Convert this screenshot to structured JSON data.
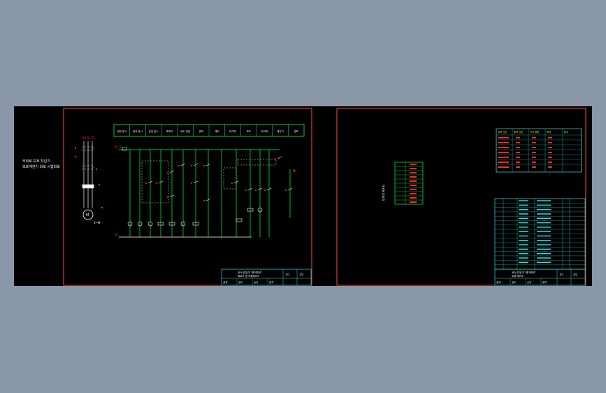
{
  "colors": {
    "background": "#8a97a8",
    "canvas": "#000000",
    "frame": "#ff4d4d",
    "wire_green": "#00ff44",
    "label_red": "#ff2a2a",
    "text_white": "#ffffff",
    "table_cyan": "#2fe0e0",
    "table_yellow": "#ffff00",
    "dashed_white": "#dddddd"
  },
  "sheet1": {
    "side_note": [
      "주회로 보호 차단기",
      "보호계전기 회로 시험회로"
    ],
    "header_cells": [
      "전원 표시",
      "정지 표시",
      "운전 표시",
      "과부하",
      "유도 전동",
      "경보",
      "제어",
      "타이머",
      "보조",
      "타이머",
      "계전기",
      "경보"
    ],
    "terminals": {
      "top": "R1 S1",
      "bottom": "S2"
    },
    "power_phases": "R1 S1 T1",
    "motor": {
      "label": "M",
      "tag": "3~M"
    },
    "title_block": {
      "title": "유도전동기 제어회로",
      "subtitle": "회로도 및 부품배치도",
      "scale": "1/1",
      "sheet": "1/2",
      "fields": [
        "설계",
        "검도",
        "승인",
        "일자"
      ]
    }
  },
  "sheet2": {
    "terminal_label": "단자대 배치도",
    "yellow_table": {
      "headers": [
        "입력 신호",
        "출력 신호",
        "기기 명칭",
        "정격",
        "비고"
      ],
      "rows": 7
    },
    "parts_list_rows": 16,
    "title_block": {
      "title": "유도전동기 제어회로",
      "subtitle": "부품 배치도",
      "scale": "1/1",
      "sheet": "2/2",
      "fields": [
        "설계",
        "검도",
        "승인",
        "일자"
      ]
    }
  }
}
